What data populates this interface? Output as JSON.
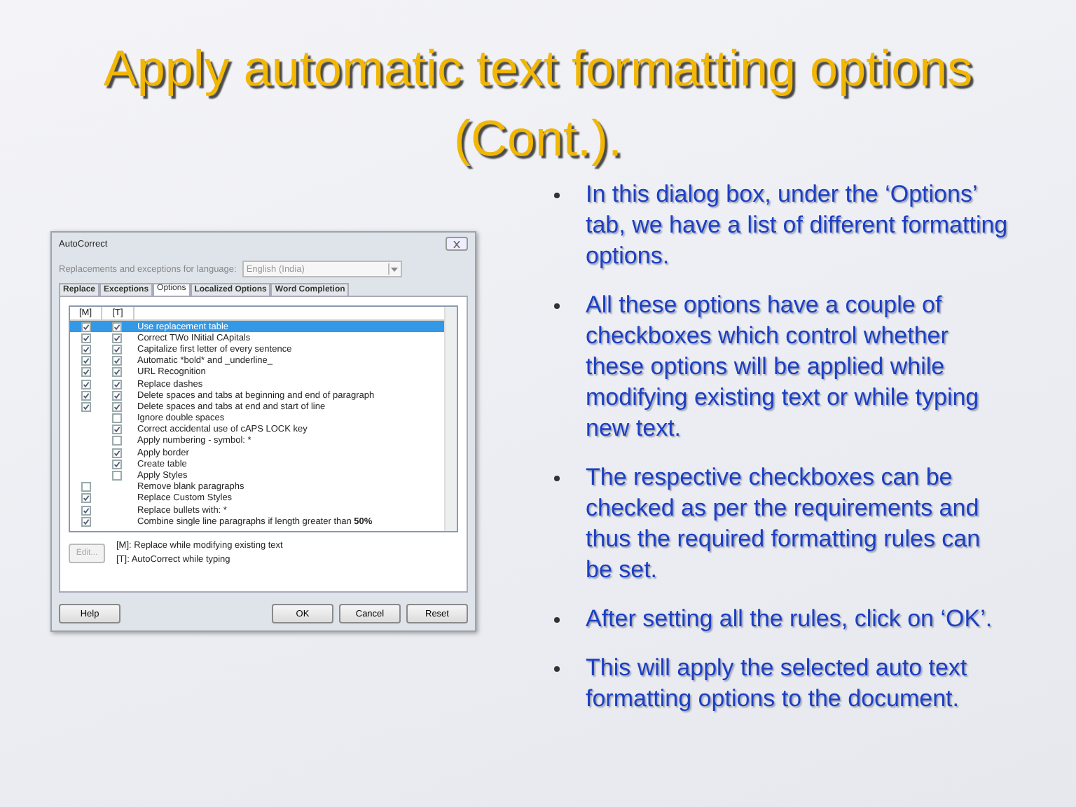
{
  "slide": {
    "title": "Apply automatic text formatting options (Cont.)."
  },
  "dialog": {
    "title": "AutoCorrect",
    "language_label": "Replacements and exceptions for language:",
    "language_value": "English (India)",
    "tabs": [
      {
        "label": "Replace",
        "selected": false
      },
      {
        "label": "Exceptions",
        "selected": false
      },
      {
        "label": "Options",
        "selected": true
      },
      {
        "label": "Localized Options",
        "selected": false
      },
      {
        "label": "Word Completion",
        "selected": false
      }
    ],
    "columns": [
      "[M]",
      "[T]"
    ],
    "options": [
      {
        "label": "Use replacement table",
        "selected": true,
        "m": true,
        "t": true
      },
      {
        "label": "Correct TWo INitial CApitals",
        "selected": false,
        "m": true,
        "t": true
      },
      {
        "label": "Capitalize first letter of every sentence",
        "selected": false,
        "m": true,
        "t": true
      },
      {
        "label": "Automatic *bold* and _underline_",
        "selected": false,
        "m": true,
        "t": true
      },
      {
        "label": "URL Recognition",
        "selected": false,
        "m": true,
        "t": true
      },
      {
        "label": "Replace dashes",
        "selected": false,
        "m": true,
        "t": true
      },
      {
        "label": "Delete spaces and tabs at beginning and end of paragraph",
        "selected": false,
        "m": true,
        "t": true
      },
      {
        "label": "Delete spaces and tabs at end and start of line",
        "selected": false,
        "m": true,
        "t": true
      },
      {
        "label": "Ignore double spaces",
        "selected": false,
        "t": false
      },
      {
        "label": "Correct accidental use of cAPS LOCK key",
        "selected": false,
        "t": true
      },
      {
        "label": "Apply numbering - symbol: *",
        "selected": false,
        "t": false
      },
      {
        "label": "Apply border",
        "selected": false,
        "t": true
      },
      {
        "label": "Create table",
        "selected": false,
        "t": true
      },
      {
        "label": "Apply Styles",
        "selected": false,
        "t": false
      },
      {
        "label": "Remove blank paragraphs",
        "selected": false,
        "m": false
      },
      {
        "label": "Replace Custom Styles",
        "selected": false,
        "m": true
      },
      {
        "label": "Replace bullets with: *",
        "selected": false,
        "m": true
      },
      {
        "label": "Combine single line paragraphs if length greater than",
        "value": "50%",
        "selected": false,
        "m": true
      }
    ],
    "edit_button": {
      "label": "Edit...",
      "disabled": true
    },
    "legend": [
      "[M]: Replace while modifying existing text",
      "[T]: AutoCorrect while typing"
    ],
    "buttons": [
      {
        "label": "Help"
      },
      {
        "label": "OK"
      },
      {
        "label": "Cancel"
      },
      {
        "label": "Reset"
      }
    ]
  },
  "bullets": [
    "In this dialog box, under the ‘Options’ tab, we have a list of different formatting options.",
    "All these options have a couple of checkboxes which control whether these options will be applied while modifying existing text or while typing new text.",
    "The respective checkboxes can be checked as per the requirements and thus the required formatting rules can be set.",
    "After setting all the rules, click on ‘OK’.",
    "This will apply the selected auto text formatting options to the document."
  ]
}
